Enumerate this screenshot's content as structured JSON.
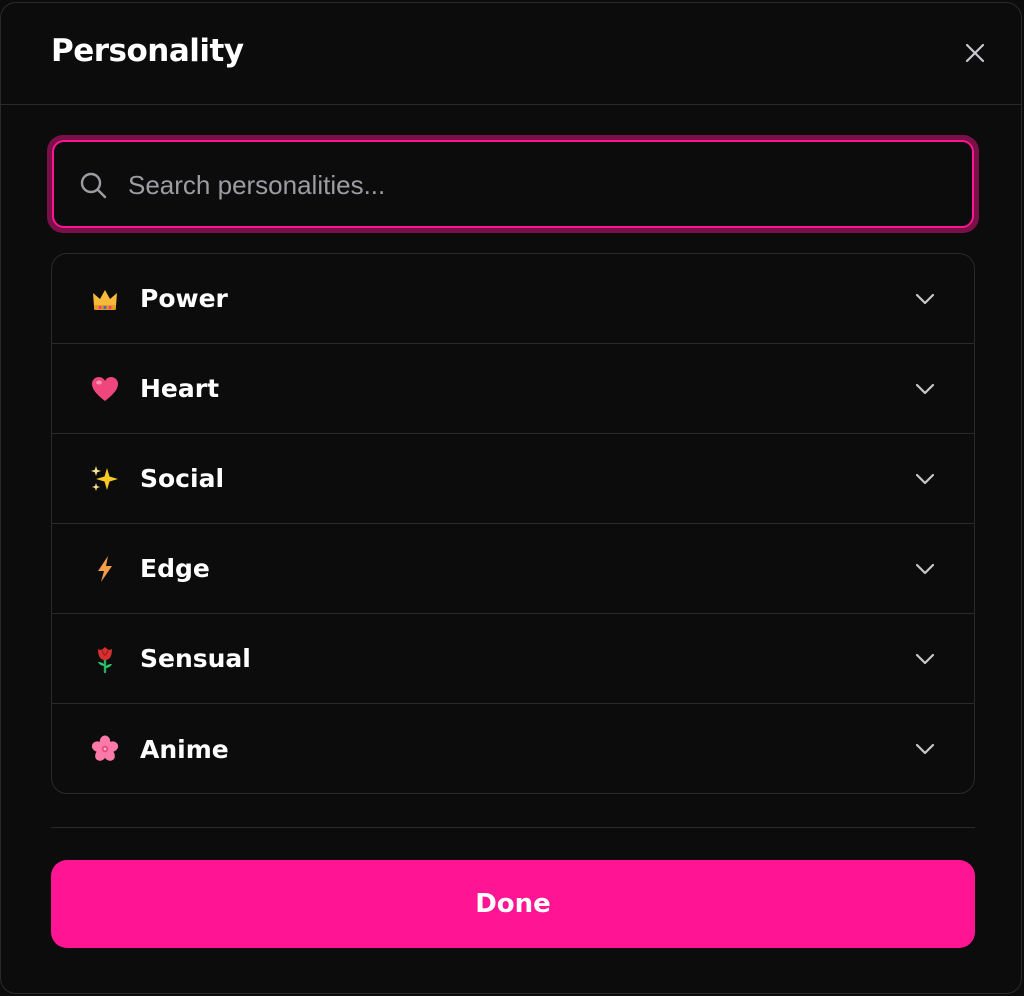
{
  "dialog": {
    "title": "Personality",
    "close_icon": "close-icon"
  },
  "search": {
    "placeholder": "Search personalities...",
    "value": "",
    "icon": "search-icon"
  },
  "categories": [
    {
      "label": "Power",
      "icon": "crown-icon"
    },
    {
      "label": "Heart",
      "icon": "heart-icon"
    },
    {
      "label": "Social",
      "icon": "sparkles-icon"
    },
    {
      "label": "Edge",
      "icon": "lightning-icon"
    },
    {
      "label": "Sensual",
      "icon": "rose-icon"
    },
    {
      "label": "Anime",
      "icon": "cherry-blossom-icon"
    }
  ],
  "footer": {
    "done_label": "Done"
  },
  "colors": {
    "accent": "#ff1493",
    "background": "#0c0c0d",
    "border": "#2a2a2d",
    "placeholder": "#9c9ca3"
  }
}
